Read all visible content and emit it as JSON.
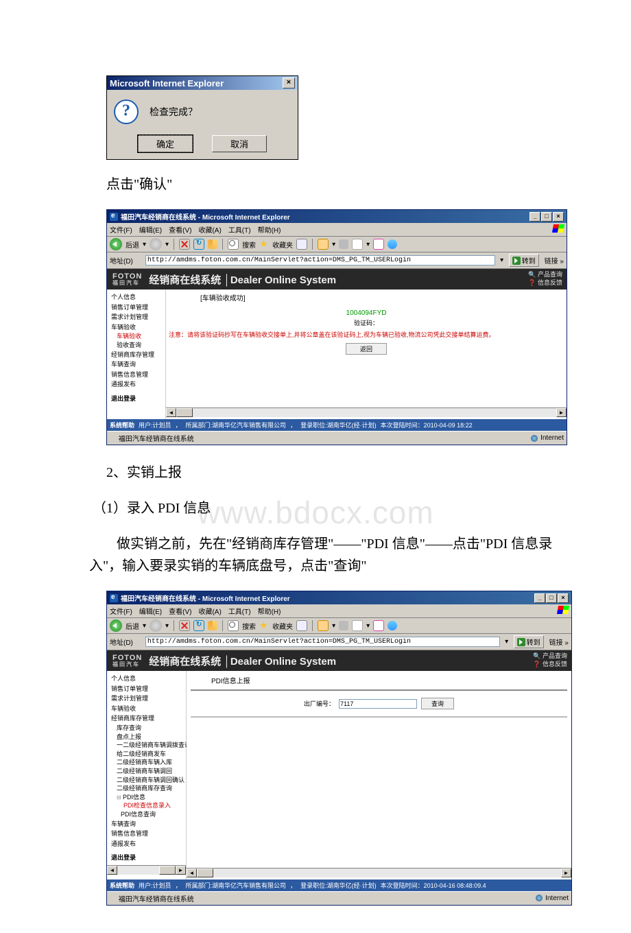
{
  "dialog": {
    "title": "Microsoft Internet Explorer",
    "message": "检查完成？",
    "ok": "确定",
    "cancel": "取消"
  },
  "text": {
    "line1": "点击\"确认\"",
    "section_num": "2、实销上报",
    "section_sub": "（1）录入 PDI 信息",
    "para": "做实销之前，先在\"经销商库存管理\"——\"PDI 信息\"——点击\"PDI 信息录入\"，输入要录实销的车辆底盘号，点击\"查询\""
  },
  "watermark": "www.bdocx.com",
  "ie_common": {
    "title": "福田汽车经销商在线系统 - Microsoft Internet Explorer",
    "menu": {
      "file": "文件(F)",
      "edit": "编辑(E)",
      "view": "查看(V)",
      "fav": "收藏(A)",
      "tools": "工具(T)",
      "help": "帮助(H)"
    },
    "toolbar": {
      "back": "后退",
      "search": "搜索",
      "favorites": "收藏夹"
    },
    "addr_label": "地址(D)",
    "url": "http://amdms.foton.com.cn/MainServlet?action=DMS_PG_TM_USERLogin",
    "go": "转到",
    "links": "链接 »",
    "foton_en": "FOTON",
    "foton_cn": "福田汽车",
    "system_title": "经销商在线系统 │Dealer Online System",
    "hdr_r1": "产品查询",
    "hdr_r2": "信息反馈",
    "status_left": "福田汽车经销商在线系统",
    "status_right": "Internet"
  },
  "screen1": {
    "sidebar": [
      "个人信息",
      "销售订单管理",
      "需求计划管理",
      "车辆验收",
      "车辆验收",
      "验收查询",
      "经销商库存管理",
      "车辆查询",
      "销售信息管理",
      "通报发布",
      "退出登录"
    ],
    "pane_title": "[车辆验收成功]",
    "code": "1004094FYD",
    "code_label": "验证码：",
    "note_prefix": "注意：",
    "note": "请将该验证码抄写在车辆验收交接单上,并将公章盖在该验证码上,视为车辆已验收,物流公司凭此交接单结算运费。",
    "back_btn": "返回",
    "footer": {
      "help": "系统帮助",
      "user_lbl": "用户:计划员",
      "dept": "所属部门:湖南华亿汽车销售有限公司",
      "pos": "登录职位:湖南华亿(经·计划)",
      "time": "本次登陆时间：2010-04-09 18:22"
    }
  },
  "screen2": {
    "sidebar_top": [
      "个人信息",
      "销售订单管理",
      "需求计划管理",
      "车辆验收",
      "经销商库存管理"
    ],
    "sidebar_sub": [
      "库存查询",
      "盘点上报",
      "一二级经销商车辆调拨查询",
      "给二级经销商发车",
      "二级经销商车辆入库",
      "二级经销商车辆调回",
      "二级经销商车辆调回确认",
      "二级经销商库存查询"
    ],
    "pdi_parent": "PDI信息",
    "pdi_entry": "PDI检查信息录入",
    "pdi_query": "PDI信息查询",
    "sidebar_bottom": [
      "车辆查询",
      "销售信息管理",
      "通报发布",
      "退出登录"
    ],
    "pane_title": "PDI信息上报",
    "field_label": "出厂编号：",
    "field_value": "7117",
    "query_btn": "查询",
    "footer": {
      "help": "系统帮助",
      "user_lbl": "用户:计划员",
      "dept": "所属部门:湖南华亿汽车销售有限公司",
      "pos": "登录职位:湖南华亿(经·计划)",
      "time": "本次登陆时间：2010-04-16 08:48:09.4"
    }
  }
}
